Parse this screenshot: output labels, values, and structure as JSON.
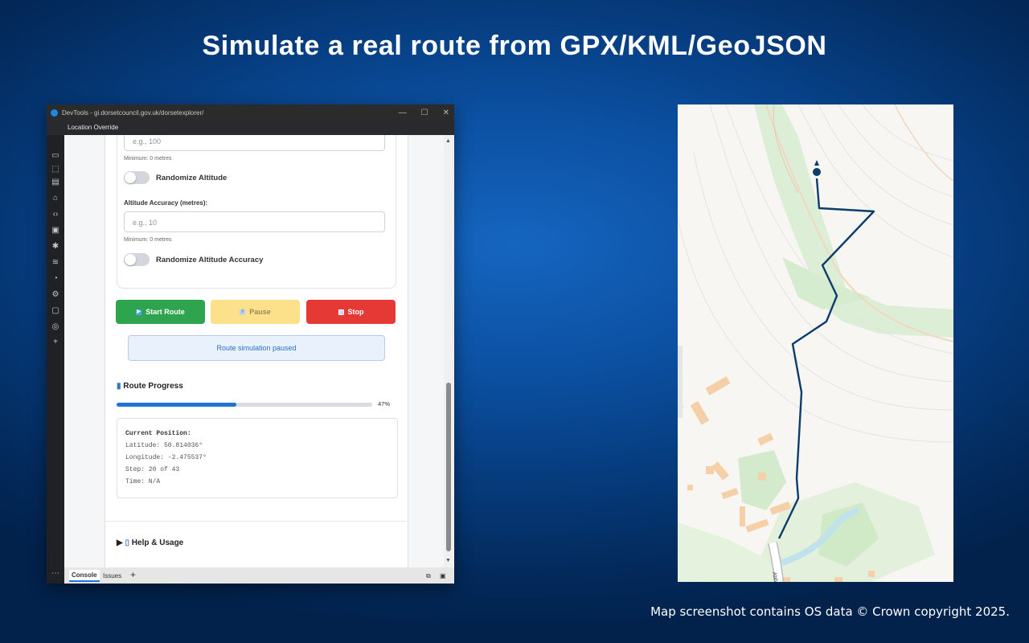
{
  "headline": "Simulate a real route from GPX/KML/GeoJSON",
  "copyright": "Map screenshot contains OS data © Crown copyright 2025.",
  "devtools": {
    "window_title": "DevTools - gi.dorsetcouncil.gov.uk/dorsetexplorer/",
    "panel_tab": "Location Override",
    "bottom_tabs": [
      "Console",
      "Issues"
    ]
  },
  "form": {
    "altitude_placeholder": "e.g., 100",
    "altitude_hint": "Minimum: 0 metres",
    "randomize_altitude": "Randomize Altitude",
    "altitude_accuracy_label": "Altitude Accuracy (metres):",
    "altitude_accuracy_placeholder": "e.g., 10",
    "altitude_accuracy_hint": "Minimum: 0 metres",
    "randomize_altitude_accuracy": "Randomize Altitude Accuracy"
  },
  "controls": {
    "start": "Start Route",
    "pause": "Pause",
    "stop": "Stop",
    "start_color": "#2ea44f",
    "pause_color": "#fde08a",
    "stop_color": "#e53935"
  },
  "status_message": "Route simulation paused",
  "progress": {
    "heading": "Route Progress",
    "percent_label": "47%",
    "fraction": 0.47
  },
  "position": {
    "heading": "Current Position:",
    "latitude": "Latitude: 50.814036°",
    "longitude": "Longitude: -2.475537°",
    "step": "Step: 20 of 43",
    "time": "Time: N/A"
  },
  "help": "Help & Usage",
  "map": {
    "road_label": "Abb..."
  }
}
